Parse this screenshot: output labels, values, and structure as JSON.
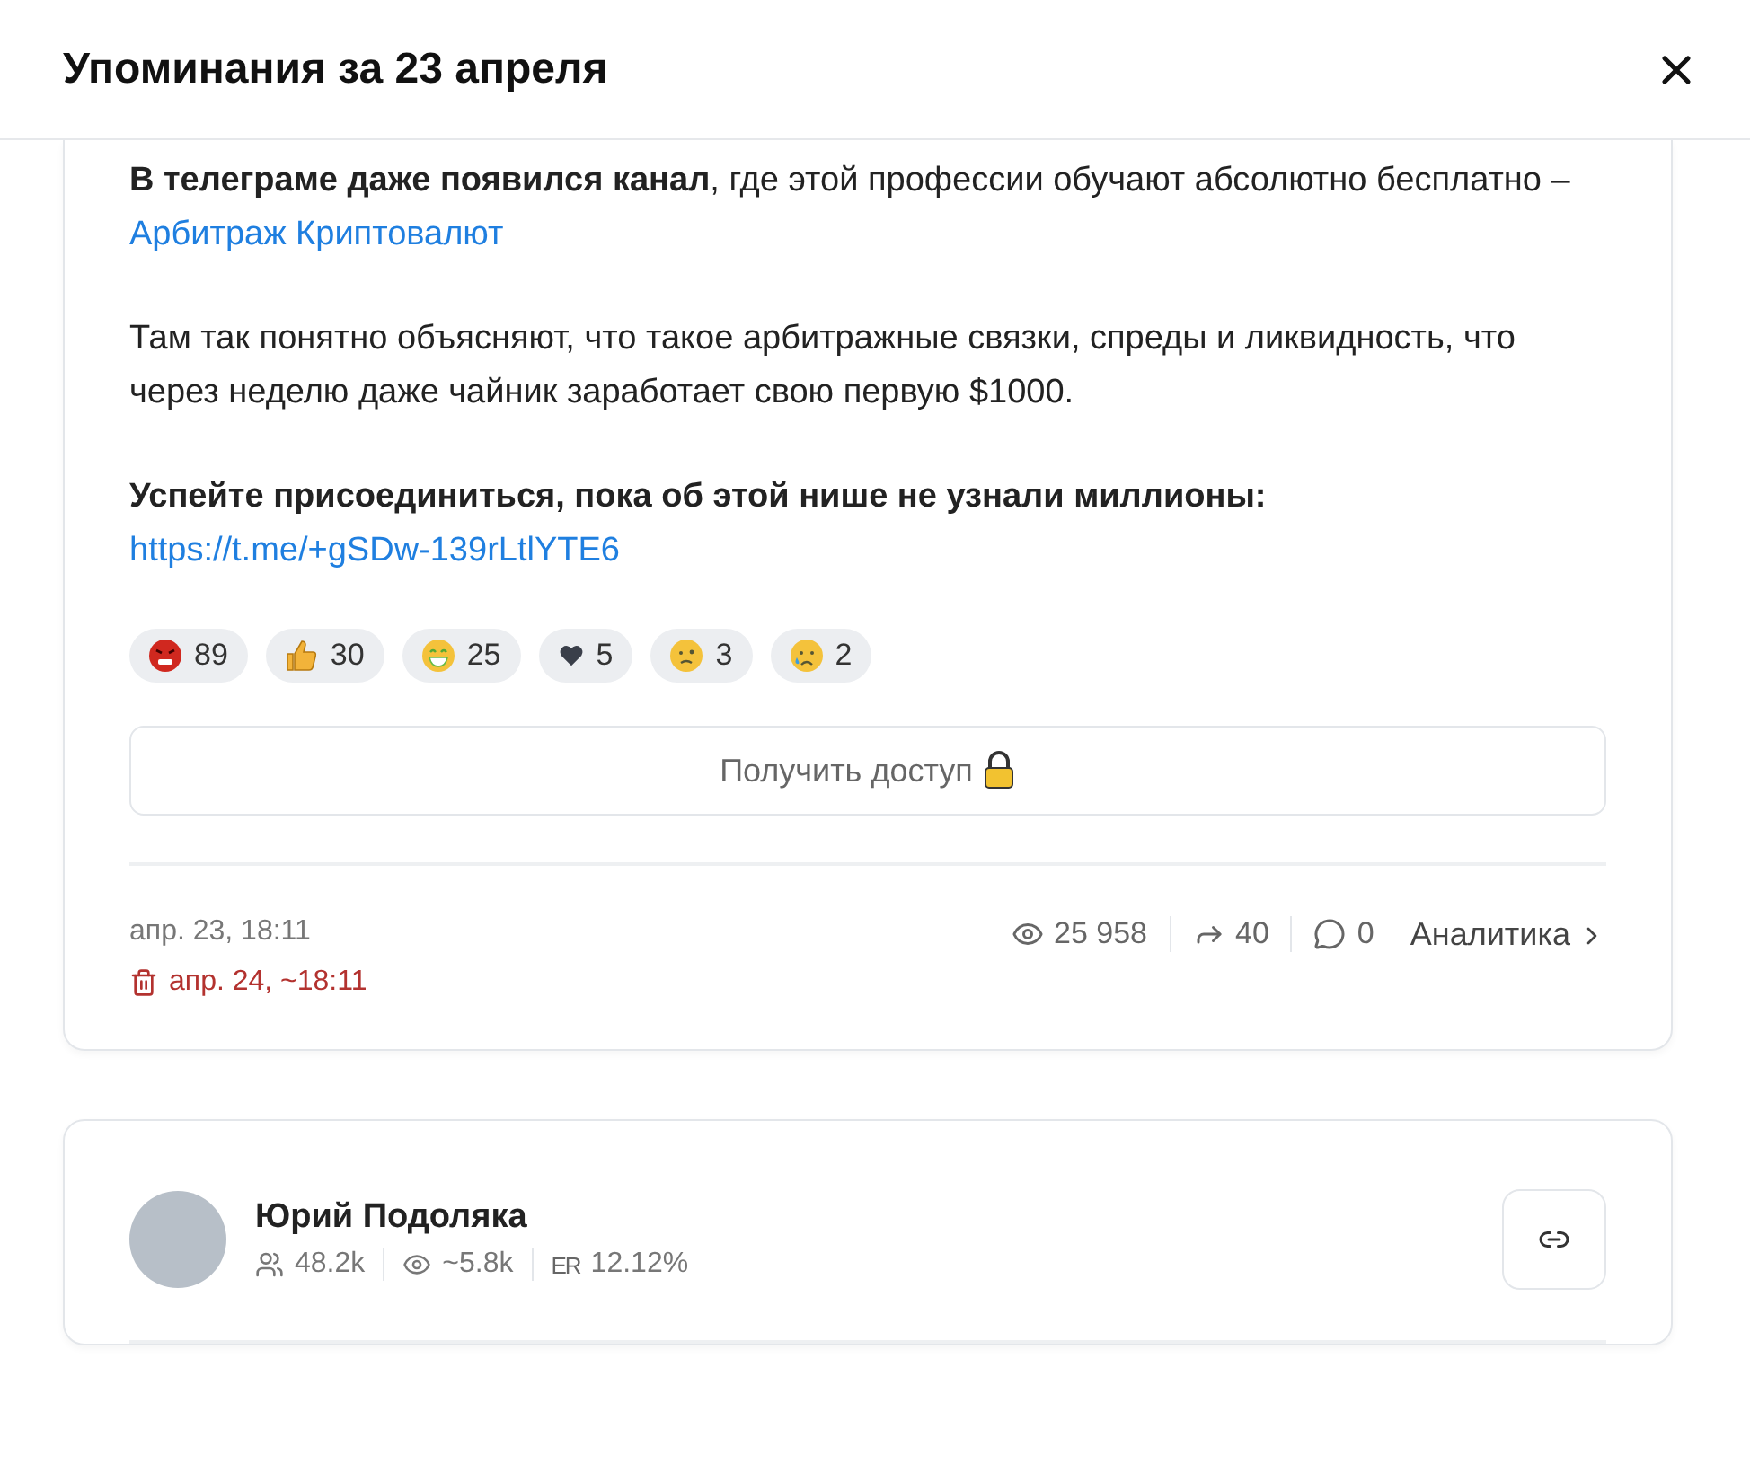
{
  "dialog": {
    "title": "Упоминания за 23 апреля"
  },
  "post": {
    "paragraphs": [
      [
        {
          "kind": "text",
          "text": "**В телеграме даже появился канал**, где этой профессии обучают абсолютно бесплатно – "
        },
        {
          "kind": "link",
          "text": "Арбитраж Криптовалют"
        }
      ],
      [
        {
          "kind": "text",
          "text": "Там так понятно объясняют, что такое арбитражные связки, спреды и ликвидность, что через неделю даже чайник заработает свою первую $1000."
        }
      ],
      [
        {
          "kind": "text",
          "text": "**Успейте присоединиться, пока об этой нише не узнали миллионы:** "
        },
        {
          "kind": "link",
          "text": "https://t.me/+gSDw-139rLtlYTE6"
        }
      ]
    ],
    "reactions": [
      {
        "kind": "angry",
        "count": "89"
      },
      {
        "kind": "thumbs-up",
        "count": "30"
      },
      {
        "kind": "grin",
        "count": "25"
      },
      {
        "kind": "heart",
        "count": "5"
      },
      {
        "kind": "woozy",
        "count": "3"
      },
      {
        "kind": "sad",
        "count": "2"
      }
    ],
    "access_button": "Получить доступ",
    "date": "апр. 23, 18:11",
    "deletion_date": "апр. 24, ~18:11",
    "views": "25 958",
    "shares": "40",
    "comments": "0",
    "analytics_link": "Аналитика"
  },
  "channel": {
    "name": "Юрий Подоляка",
    "subscribers": "48.2k",
    "reach": "~5.8k",
    "er_label": "ER",
    "er": "12.12%"
  }
}
